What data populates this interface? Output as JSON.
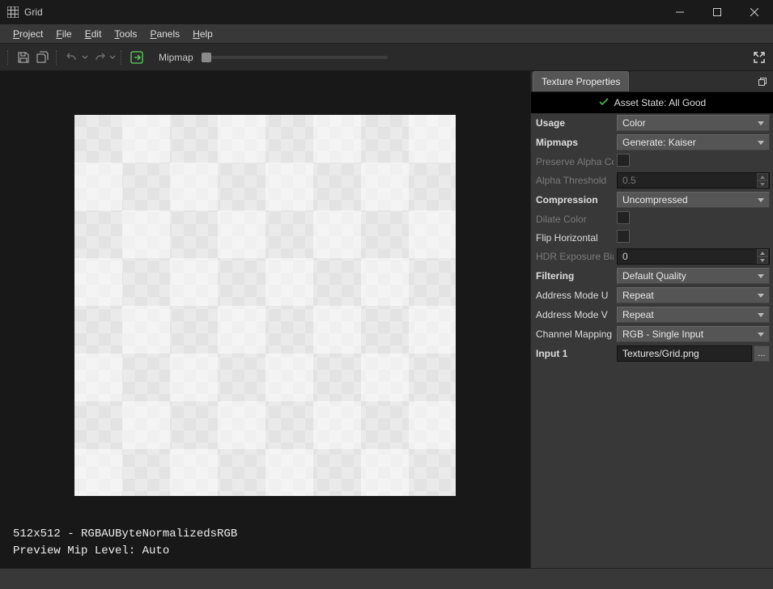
{
  "window": {
    "title": "Grid"
  },
  "menu": [
    "Project",
    "File",
    "Edit",
    "Tools",
    "Panels",
    "Help"
  ],
  "toolbar": {
    "mipmap_label": "Mipmap"
  },
  "viewport": {
    "info_line1": "512x512 - RGBAUByteNormalizedsRGB",
    "info_line2": "Preview Mip Level: Auto"
  },
  "panel": {
    "tab": "Texture Properties",
    "asset_state": "Asset State: All Good"
  },
  "props": {
    "usage": {
      "label": "Usage",
      "value": "Color"
    },
    "mipmaps": {
      "label": "Mipmaps",
      "value": "Generate: Kaiser"
    },
    "preserve_alpha": {
      "label": "Preserve Alpha Coverage"
    },
    "alpha_threshold": {
      "label": "Alpha Threshold",
      "value": "0.5"
    },
    "compression": {
      "label": "Compression",
      "value": "Uncompressed"
    },
    "dilate_color": {
      "label": "Dilate Color"
    },
    "flip_horizontal": {
      "label": "Flip Horizontal"
    },
    "hdr_bias": {
      "label": "HDR Exposure Bias",
      "value": "0"
    },
    "filtering": {
      "label": "Filtering",
      "value": "Default Quality"
    },
    "addr_u": {
      "label": "Address Mode U",
      "value": "Repeat"
    },
    "addr_v": {
      "label": "Address Mode V",
      "value": "Repeat"
    },
    "channel_mapping": {
      "label": "Channel Mapping",
      "value": "RGB - Single Input"
    },
    "input1": {
      "label": "Input 1",
      "value": "Textures/Grid.png",
      "browse": "..."
    }
  }
}
